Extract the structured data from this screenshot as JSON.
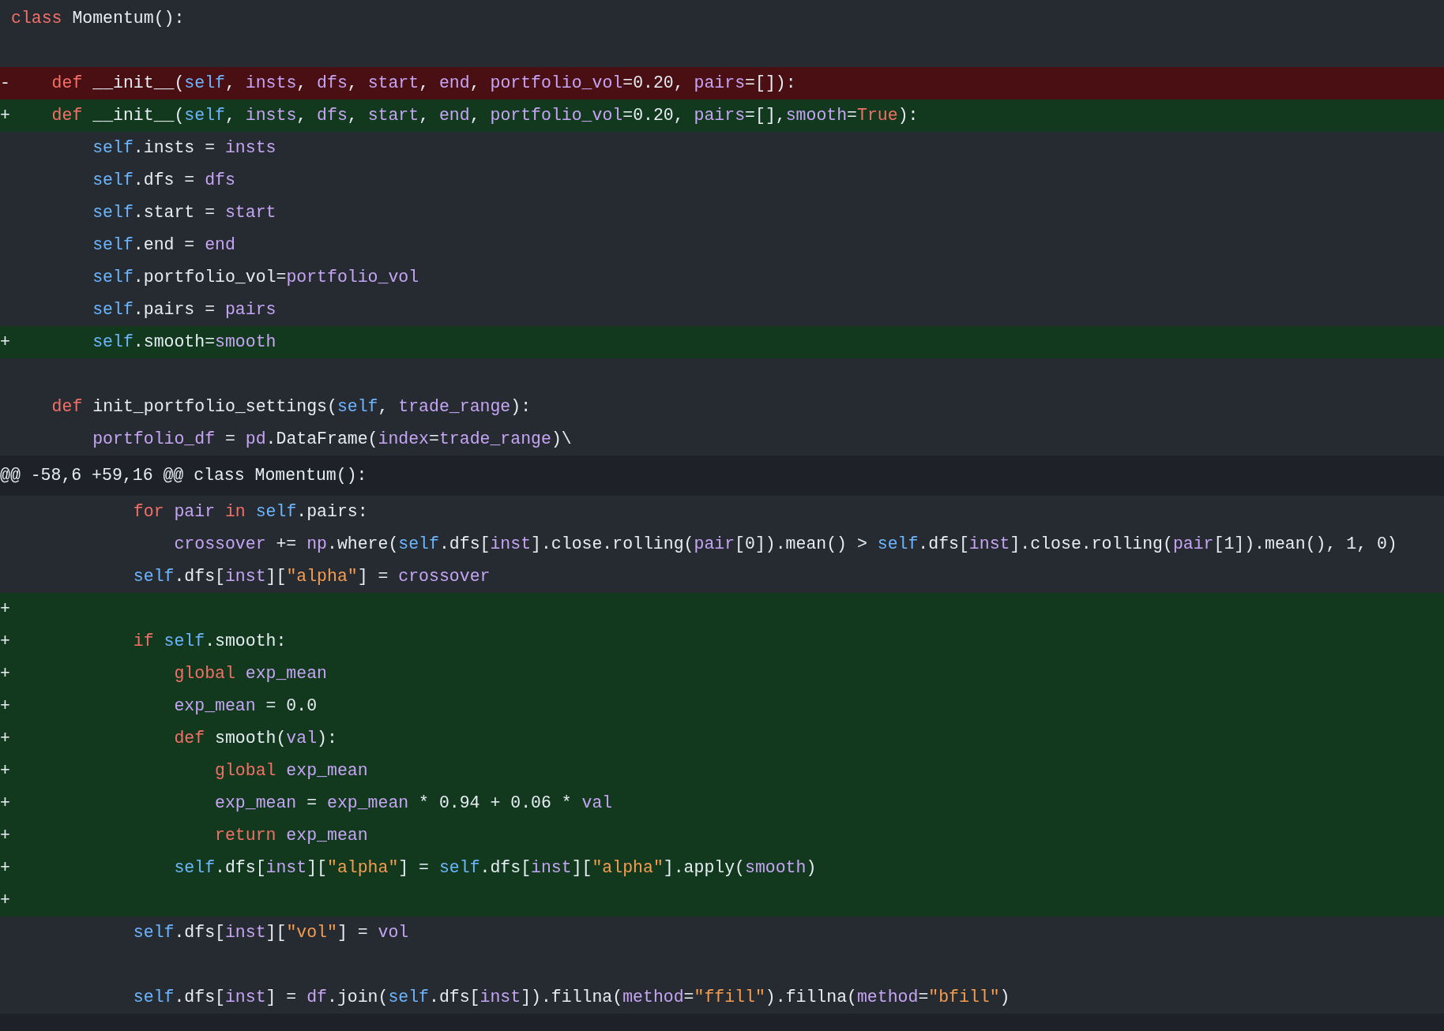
{
  "diff_lines": [
    {
      "kind": "context",
      "tokens": [
        {
          "kind": "keyword",
          "text": "class"
        },
        {
          "kind": "plain",
          "text": " Momentum():"
        }
      ]
    },
    {
      "kind": "context"
    },
    {
      "kind": "deleted",
      "marker": "-",
      "tokens": [
        {
          "kind": "keyword",
          "text": "    def"
        },
        {
          "kind": "plain",
          "text": " __init__("
        },
        {
          "kind": "self",
          "text": "self"
        },
        {
          "kind": "plain",
          "text": ", "
        },
        {
          "kind": "name",
          "text": "insts"
        },
        {
          "kind": "plain",
          "text": ", "
        },
        {
          "kind": "name",
          "text": "dfs"
        },
        {
          "kind": "plain",
          "text": ", "
        },
        {
          "kind": "name",
          "text": "start"
        },
        {
          "kind": "plain",
          "text": ", "
        },
        {
          "kind": "name",
          "text": "end"
        },
        {
          "kind": "plain",
          "text": ", "
        },
        {
          "kind": "name",
          "text": "portfolio_vol"
        },
        {
          "kind": "plain",
          "text": "=0.20, "
        },
        {
          "kind": "name",
          "text": "pairs"
        },
        {
          "kind": "plain",
          "text": "=[]):"
        }
      ]
    },
    {
      "kind": "added",
      "marker": "+",
      "tokens": [
        {
          "kind": "keyword",
          "text": "    def"
        },
        {
          "kind": "plain",
          "text": " __init__("
        },
        {
          "kind": "self",
          "text": "self"
        },
        {
          "kind": "plain",
          "text": ", "
        },
        {
          "kind": "name",
          "text": "insts"
        },
        {
          "kind": "plain",
          "text": ", "
        },
        {
          "kind": "name",
          "text": "dfs"
        },
        {
          "kind": "plain",
          "text": ", "
        },
        {
          "kind": "name",
          "text": "start"
        },
        {
          "kind": "plain",
          "text": ", "
        },
        {
          "kind": "name",
          "text": "end"
        },
        {
          "kind": "plain",
          "text": ", "
        },
        {
          "kind": "name",
          "text": "portfolio_vol"
        },
        {
          "kind": "plain",
          "text": "=0.20, "
        },
        {
          "kind": "name",
          "text": "pairs"
        },
        {
          "kind": "plain",
          "text": "=[],"
        },
        {
          "kind": "name",
          "text": "smooth"
        },
        {
          "kind": "plain",
          "text": "="
        },
        {
          "kind": "keyword",
          "text": "True"
        },
        {
          "kind": "plain",
          "text": "):"
        }
      ]
    },
    {
      "kind": "context",
      "tokens": [
        {
          "kind": "self",
          "text": "        self"
        },
        {
          "kind": "plain",
          "text": ".insts = "
        },
        {
          "kind": "name",
          "text": "insts"
        }
      ]
    },
    {
      "kind": "context",
      "tokens": [
        {
          "kind": "self",
          "text": "        self"
        },
        {
          "kind": "plain",
          "text": ".dfs = "
        },
        {
          "kind": "name",
          "text": "dfs"
        }
      ]
    },
    {
      "kind": "context",
      "tokens": [
        {
          "kind": "self",
          "text": "        self"
        },
        {
          "kind": "plain",
          "text": ".start = "
        },
        {
          "kind": "name",
          "text": "start"
        }
      ]
    },
    {
      "kind": "context",
      "tokens": [
        {
          "kind": "self",
          "text": "        self"
        },
        {
          "kind": "plain",
          "text": ".end = "
        },
        {
          "kind": "name",
          "text": "end"
        }
      ]
    },
    {
      "kind": "context",
      "tokens": [
        {
          "kind": "self",
          "text": "        self"
        },
        {
          "kind": "plain",
          "text": ".portfolio_vol="
        },
        {
          "kind": "name",
          "text": "portfolio_vol"
        }
      ]
    },
    {
      "kind": "context",
      "tokens": [
        {
          "kind": "self",
          "text": "        self"
        },
        {
          "kind": "plain",
          "text": ".pairs = "
        },
        {
          "kind": "name",
          "text": "pairs"
        }
      ]
    },
    {
      "kind": "added",
      "marker": "+",
      "tokens": [
        {
          "kind": "self",
          "text": "        self"
        },
        {
          "kind": "plain",
          "text": ".smooth="
        },
        {
          "kind": "name",
          "text": "smooth"
        }
      ]
    },
    {
      "kind": "context"
    },
    {
      "kind": "context",
      "tokens": [
        {
          "kind": "keyword",
          "text": "    def"
        },
        {
          "kind": "plain",
          "text": " init_portfolio_settings("
        },
        {
          "kind": "self",
          "text": "self"
        },
        {
          "kind": "plain",
          "text": ", "
        },
        {
          "kind": "name",
          "text": "trade_range"
        },
        {
          "kind": "plain",
          "text": "):"
        }
      ]
    },
    {
      "kind": "context",
      "tokens": [
        {
          "kind": "name",
          "text": "        portfolio_df"
        },
        {
          "kind": "plain",
          "text": " = "
        },
        {
          "kind": "name",
          "text": "pd"
        },
        {
          "kind": "plain",
          "text": ".DataFrame("
        },
        {
          "kind": "name",
          "text": "index"
        },
        {
          "kind": "plain",
          "text": "="
        },
        {
          "kind": "name",
          "text": "trade_range"
        },
        {
          "kind": "plain",
          "text": ")\\"
        }
      ]
    },
    {
      "kind": "hunk",
      "tokens": [
        {
          "kind": "plain",
          "text": "@@ -58,6 +59,16 @@ class Momentum():"
        }
      ]
    },
    {
      "kind": "context",
      "tokens": [
        {
          "kind": "keyword",
          "text": "            for"
        },
        {
          "kind": "name",
          "text": " pair"
        },
        {
          "kind": "keyword",
          "text": " in"
        },
        {
          "kind": "self",
          "text": " self"
        },
        {
          "kind": "plain",
          "text": ".pairs:"
        }
      ]
    },
    {
      "kind": "context",
      "tokens": [
        {
          "kind": "name",
          "text": "                crossover"
        },
        {
          "kind": "plain",
          "text": " += "
        },
        {
          "kind": "name",
          "text": "np"
        },
        {
          "kind": "plain",
          "text": ".where("
        },
        {
          "kind": "self",
          "text": "self"
        },
        {
          "kind": "plain",
          "text": ".dfs["
        },
        {
          "kind": "name",
          "text": "inst"
        },
        {
          "kind": "plain",
          "text": "].close.rolling("
        },
        {
          "kind": "name",
          "text": "pair"
        },
        {
          "kind": "plain",
          "text": "[0]).mean() > "
        },
        {
          "kind": "self",
          "text": "self"
        },
        {
          "kind": "plain",
          "text": ".dfs["
        },
        {
          "kind": "name",
          "text": "inst"
        },
        {
          "kind": "plain",
          "text": "].close.rolling("
        },
        {
          "kind": "name",
          "text": "pair"
        },
        {
          "kind": "plain",
          "text": "[1]).mean(), 1, 0)"
        }
      ]
    },
    {
      "kind": "context",
      "tokens": [
        {
          "kind": "self",
          "text": "            self"
        },
        {
          "kind": "plain",
          "text": ".dfs["
        },
        {
          "kind": "name",
          "text": "inst"
        },
        {
          "kind": "plain",
          "text": "]["
        },
        {
          "kind": "string",
          "text": "\"alpha\""
        },
        {
          "kind": "plain",
          "text": "] = "
        },
        {
          "kind": "name",
          "text": "crossover"
        }
      ]
    },
    {
      "kind": "added",
      "marker": "+"
    },
    {
      "kind": "added",
      "marker": "+",
      "tokens": [
        {
          "kind": "keyword",
          "text": "            if"
        },
        {
          "kind": "self",
          "text": " self"
        },
        {
          "kind": "plain",
          "text": ".smooth:"
        }
      ]
    },
    {
      "kind": "added",
      "marker": "+",
      "tokens": [
        {
          "kind": "keyword",
          "text": "                global"
        },
        {
          "kind": "name",
          "text": " exp_mean"
        }
      ]
    },
    {
      "kind": "added",
      "marker": "+",
      "tokens": [
        {
          "kind": "name",
          "text": "                exp_mean"
        },
        {
          "kind": "plain",
          "text": " = 0.0"
        }
      ]
    },
    {
      "kind": "added",
      "marker": "+",
      "tokens": [
        {
          "kind": "keyword",
          "text": "                def"
        },
        {
          "kind": "plain",
          "text": " smooth("
        },
        {
          "kind": "name",
          "text": "val"
        },
        {
          "kind": "plain",
          "text": "):"
        }
      ]
    },
    {
      "kind": "added",
      "marker": "+",
      "tokens": [
        {
          "kind": "keyword",
          "text": "                    global"
        },
        {
          "kind": "name",
          "text": " exp_mean"
        }
      ]
    },
    {
      "kind": "added",
      "marker": "+",
      "tokens": [
        {
          "kind": "name",
          "text": "                    exp_mean"
        },
        {
          "kind": "plain",
          "text": " = "
        },
        {
          "kind": "name",
          "text": "exp_mean"
        },
        {
          "kind": "plain",
          "text": " * 0.94 + 0.06 * "
        },
        {
          "kind": "name",
          "text": "val"
        }
      ]
    },
    {
      "kind": "added",
      "marker": "+",
      "tokens": [
        {
          "kind": "keyword",
          "text": "                    return"
        },
        {
          "kind": "name",
          "text": " exp_mean"
        }
      ]
    },
    {
      "kind": "added",
      "marker": "+",
      "tokens": [
        {
          "kind": "self",
          "text": "                self"
        },
        {
          "kind": "plain",
          "text": ".dfs["
        },
        {
          "kind": "name",
          "text": "inst"
        },
        {
          "kind": "plain",
          "text": "]["
        },
        {
          "kind": "string",
          "text": "\"alpha\""
        },
        {
          "kind": "plain",
          "text": "] = "
        },
        {
          "kind": "self",
          "text": "self"
        },
        {
          "kind": "plain",
          "text": ".dfs["
        },
        {
          "kind": "name",
          "text": "inst"
        },
        {
          "kind": "plain",
          "text": "]["
        },
        {
          "kind": "string",
          "text": "\"alpha\""
        },
        {
          "kind": "plain",
          "text": "].apply("
        },
        {
          "kind": "name",
          "text": "smooth"
        },
        {
          "kind": "plain",
          "text": ")"
        }
      ]
    },
    {
      "kind": "added",
      "marker": "+"
    },
    {
      "kind": "context",
      "tokens": [
        {
          "kind": "self",
          "text": "            self"
        },
        {
          "kind": "plain",
          "text": ".dfs["
        },
        {
          "kind": "name",
          "text": "inst"
        },
        {
          "kind": "plain",
          "text": "]["
        },
        {
          "kind": "string",
          "text": "\"vol\""
        },
        {
          "kind": "plain",
          "text": "] = "
        },
        {
          "kind": "name",
          "text": "vol"
        }
      ]
    },
    {
      "kind": "context"
    },
    {
      "kind": "context",
      "tokens": [
        {
          "kind": "self",
          "text": "            self"
        },
        {
          "kind": "plain",
          "text": ".dfs["
        },
        {
          "kind": "name",
          "text": "inst"
        },
        {
          "kind": "plain",
          "text": "] = "
        },
        {
          "kind": "name",
          "text": "df"
        },
        {
          "kind": "plain",
          "text": ".join("
        },
        {
          "kind": "self",
          "text": "self"
        },
        {
          "kind": "plain",
          "text": ".dfs["
        },
        {
          "kind": "name",
          "text": "inst"
        },
        {
          "kind": "plain",
          "text": "]).fillna("
        },
        {
          "kind": "name",
          "text": "method"
        },
        {
          "kind": "plain",
          "text": "="
        },
        {
          "kind": "string",
          "text": "\"ffill\""
        },
        {
          "kind": "plain",
          "text": ").fillna("
        },
        {
          "kind": "name",
          "text": "method"
        },
        {
          "kind": "plain",
          "text": "="
        },
        {
          "kind": "string",
          "text": "\"bfill\""
        },
        {
          "kind": "plain",
          "text": ")"
        }
      ]
    }
  ]
}
